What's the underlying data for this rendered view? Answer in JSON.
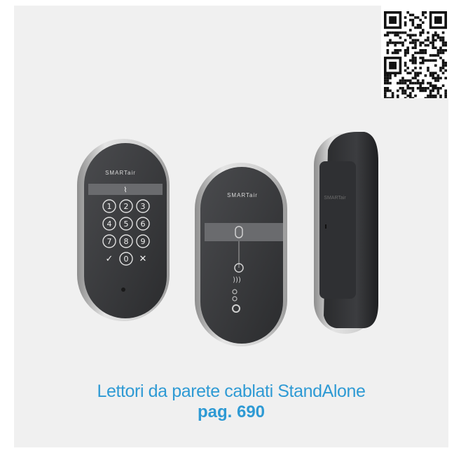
{
  "caption": {
    "title": "Lettori da parete cablati StandAlone",
    "page_ref": "pag. 690"
  },
  "qr_code": {
    "icon": "qr-code-icon"
  },
  "devices": {
    "keypad_reader": {
      "brand": "SMARTair",
      "keys": [
        "1",
        "2",
        "3",
        "4",
        "5",
        "6",
        "7",
        "8",
        "9",
        "✓",
        "0",
        "✕"
      ],
      "icon": "keypad-reader-icon"
    },
    "proximity_reader": {
      "brand": "SMARTair",
      "icon": "proximity-reader-icon"
    },
    "side_reader": {
      "brand": "SMARTair",
      "icon": "side-reader-icon"
    }
  },
  "colors": {
    "accent": "#2e9ad4",
    "panel_bg": "#f0f0f0",
    "device_body": "#3a3b3d",
    "device_frame": "#c8c8c8"
  }
}
